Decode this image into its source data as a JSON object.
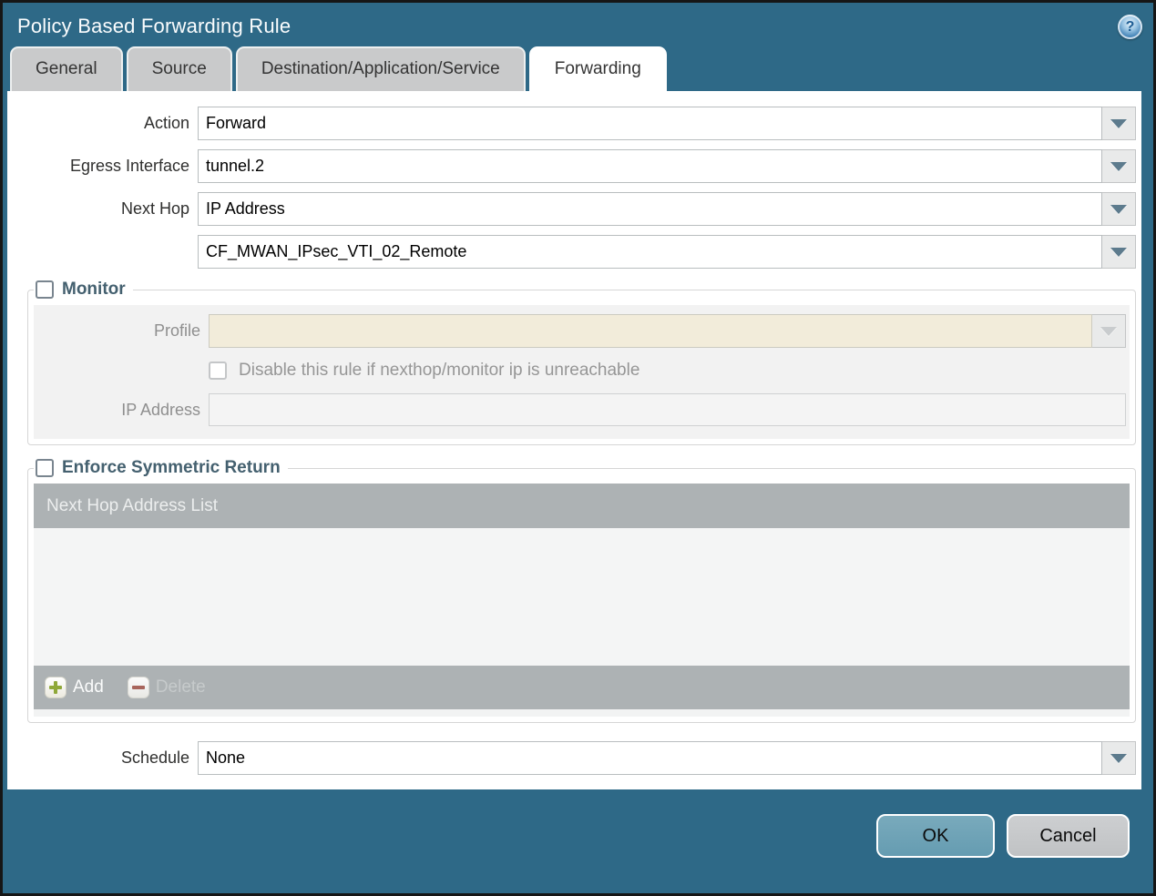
{
  "window": {
    "title": "Policy Based Forwarding Rule"
  },
  "tabs": [
    {
      "label": "General",
      "active": false
    },
    {
      "label": "Source",
      "active": false
    },
    {
      "label": "Destination/Application/Service",
      "active": false
    },
    {
      "label": "Forwarding",
      "active": true
    }
  ],
  "form": {
    "action": {
      "label": "Action",
      "value": "Forward"
    },
    "egress_interface": {
      "label": "Egress Interface",
      "value": "tunnel.2"
    },
    "next_hop": {
      "label": "Next Hop",
      "value": "IP Address"
    },
    "next_hop_address": {
      "value": "CF_MWAN_IPsec_VTI_02_Remote"
    },
    "schedule": {
      "label": "Schedule",
      "value": "None"
    }
  },
  "monitor": {
    "legend": "Monitor",
    "checked": false,
    "profile": {
      "label": "Profile",
      "value": ""
    },
    "disable_rule_label": "Disable this rule if nexthop/monitor ip is unreachable",
    "disable_rule_checked": false,
    "ip_address": {
      "label": "IP Address",
      "value": ""
    }
  },
  "symmetric_return": {
    "legend": "Enforce Symmetric Return",
    "checked": false,
    "table_header": "Next Hop Address List",
    "rows": [],
    "add_label": "Add",
    "delete_label": "Delete",
    "delete_enabled": false
  },
  "footer": {
    "ok_label": "OK",
    "cancel_label": "Cancel"
  },
  "icons": {
    "help": "help-icon",
    "dropdown": "chevron-down-icon",
    "add": "plus-icon",
    "delete": "minus-icon"
  },
  "colors": {
    "window_background": "#2e6987",
    "tab_inactive": "#c9cacb",
    "panel_gray": "#f2f2f2",
    "disabled_field_beige": "#f2ecda",
    "table_bar_gray": "#adb2b4",
    "ok_button": "#6da2b6",
    "cancel_button": "#c6c8ca",
    "legend_text": "#44606f",
    "add_icon_green": "#8fa839",
    "delete_icon_red": "#a8655c"
  }
}
